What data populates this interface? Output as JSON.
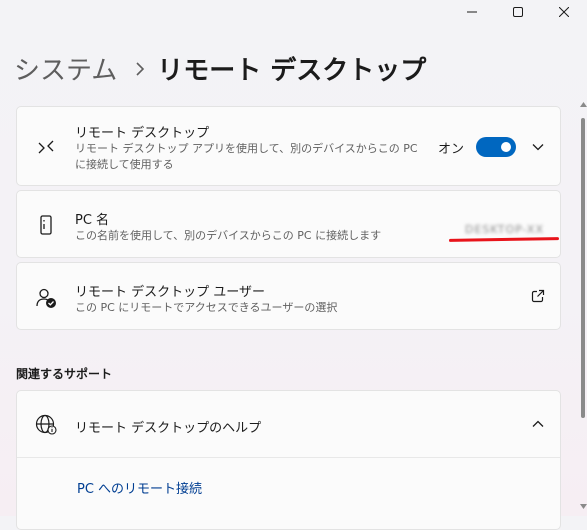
{
  "titlebar": {
    "icons": [
      "minimize-icon",
      "maximize-icon",
      "close-icon"
    ]
  },
  "breadcrumb": {
    "parent": "システム",
    "current": "リモート デスクトップ"
  },
  "remote_desktop_card": {
    "title": "リモート デスクトップ",
    "description": "リモート デスクトップ アプリを使用して、別のデバイスからこの PC に接続して使用する",
    "toggle_label": "オン",
    "toggle_on": true,
    "accent_color": "#0067c0",
    "icon": "remote-desktop-icon"
  },
  "pc_name_card": {
    "title": "PC 名",
    "description": "この名前を使用して、別のデバイスからこの PC に接続します",
    "value": "DESKTOP-XX",
    "icon": "pc-tower-icon"
  },
  "users_card": {
    "title": "リモート デスクトップ ユーザー",
    "description": "この PC にリモートでアクセスできるユーザーの選択",
    "icon": "user-check-icon"
  },
  "related_support": {
    "heading": "関連するサポート",
    "help_title": "リモート デスクトップのヘルプ",
    "help_link": "PC へのリモート接続",
    "icon": "globe-icon"
  }
}
